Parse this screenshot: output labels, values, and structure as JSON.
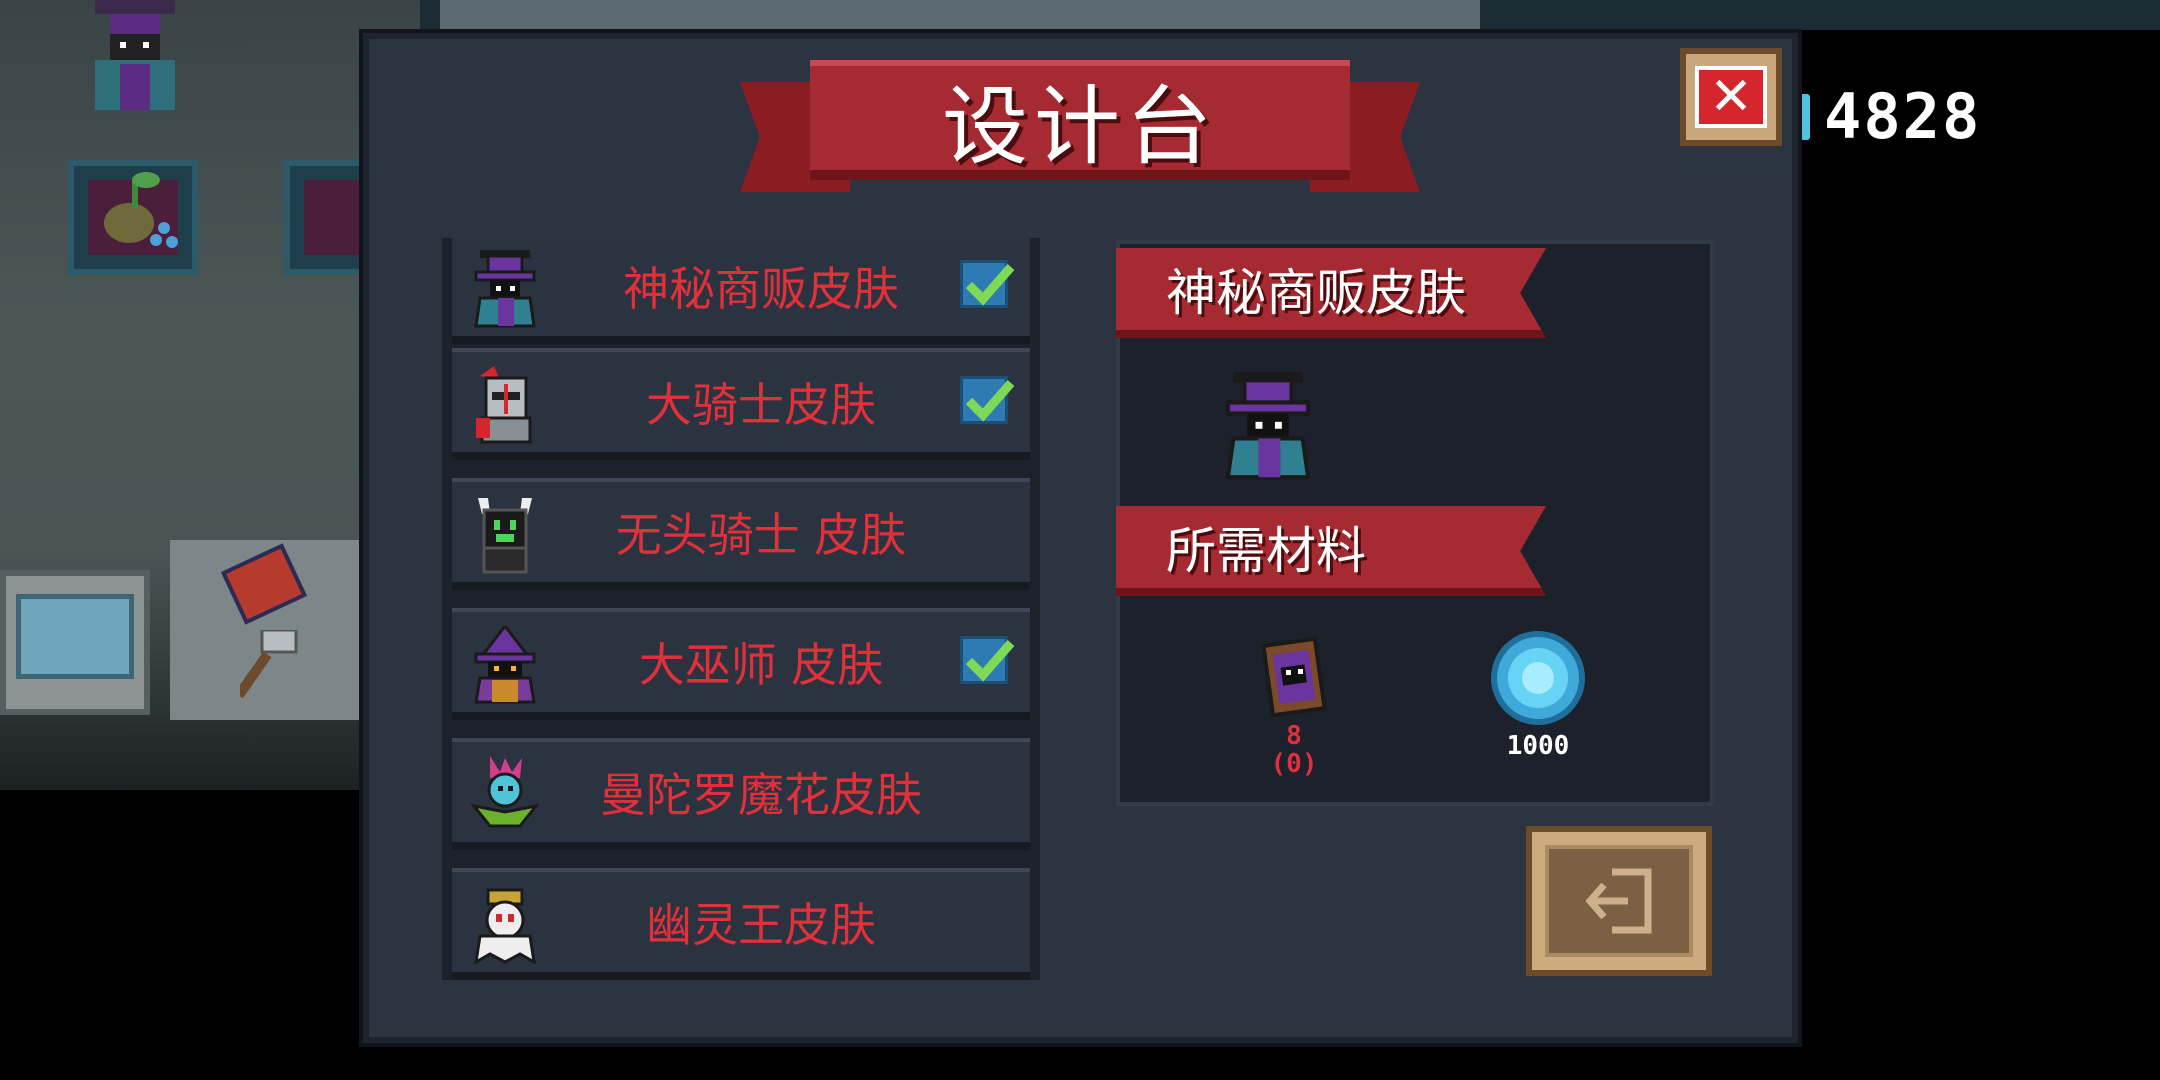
{
  "title": "设计台",
  "currency": {
    "value": "4828",
    "icon": "gem-icon"
  },
  "close_button": {
    "icon": "close-icon",
    "glyph": "✕"
  },
  "skin_list": [
    {
      "label": "神秘商贩皮肤",
      "icon": "mysterious-merchant-avatar-icon",
      "checked": true
    },
    {
      "label": "大骑士皮肤",
      "icon": "grand-knight-avatar-icon",
      "checked": true
    },
    {
      "label": "无头骑士 皮肤",
      "icon": "headless-knight-avatar-icon",
      "checked": false
    },
    {
      "label": "大巫师 皮肤",
      "icon": "grand-wizard-avatar-icon",
      "checked": true
    },
    {
      "label": "曼陀罗魔花皮肤",
      "icon": "mandrake-flower-avatar-icon",
      "checked": false
    },
    {
      "label": "幽灵王皮肤",
      "icon": "ghost-king-avatar-icon",
      "checked": false
    }
  ],
  "detail": {
    "selected_name": "神秘商贩皮肤",
    "preview_icon": "mysterious-merchant-avatar-icon",
    "materials_heading": "所需材料",
    "materials": [
      {
        "icon": "merchant-blueprint-icon",
        "amount": "8",
        "owned": "(0)",
        "color": "#e0303a"
      },
      {
        "icon": "gem-icon",
        "amount": "1000",
        "color": "#ffffff"
      }
    ]
  },
  "exit_button": {
    "icon": "exit-icon"
  },
  "colors": {
    "accent_red": "#a62a31",
    "label_red": "#e0303a",
    "check_green": "#7ed957",
    "panel_bg": "#2c3441"
  }
}
